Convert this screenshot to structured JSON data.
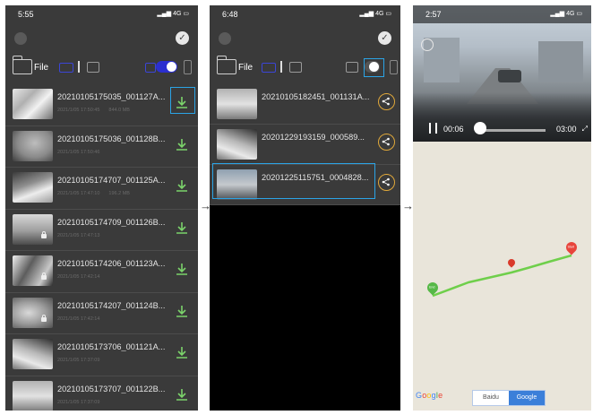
{
  "panel1": {
    "status": {
      "time": "5:55",
      "signal": "4G"
    },
    "toolbar": {
      "file_label": "File"
    },
    "files": [
      {
        "name": "20210105175035_001127A...",
        "date": "2021/1/05 17:50:45",
        "size": "844.0 MB",
        "locked": false
      },
      {
        "name": "20210105175036_001128B...",
        "date": "2021/1/05 17:50:46",
        "size": "",
        "locked": false
      },
      {
        "name": "20210105174707_001125A...",
        "date": "2021/1/05 17:47:10",
        "size": "196.2 MB",
        "locked": false
      },
      {
        "name": "20210105174709_001126B...",
        "date": "2021/1/05 17:47:13",
        "size": "",
        "locked": true
      },
      {
        "name": "20210105174206_001123A...",
        "date": "2021/1/05 17:42:14",
        "size": "",
        "locked": true
      },
      {
        "name": "20210105174207_001124B...",
        "date": "2021/1/05 17:42:14",
        "size": "",
        "locked": true
      },
      {
        "name": "20210105173706_001121A...",
        "date": "2021/1/05 17:37:09",
        "size": "",
        "locked": false
      },
      {
        "name": "20210105173707_001122B...",
        "date": "2021/1/05 17:37:09",
        "size": "",
        "locked": false
      }
    ]
  },
  "panel2": {
    "status": {
      "time": "6:48",
      "signal": "4G"
    },
    "toolbar": {
      "file_label": "File"
    },
    "files": [
      {
        "name": "20210105182451_001131A..."
      },
      {
        "name": "20201229193159_000589..."
      },
      {
        "name": "20201225115751_0004828..."
      }
    ]
  },
  "panel3": {
    "status": {
      "time": "2:57",
      "signal": "4G"
    },
    "player": {
      "current_time": "00:06",
      "total_time": "03:00",
      "progress": 0.03
    },
    "map": {
      "start_label": "End",
      "end_label": "Start",
      "map_providers": [
        "Baidu",
        "Google"
      ],
      "selected_provider": "Google"
    }
  },
  "colors": {
    "highlight": "#2ba4e6",
    "route": "#6fcf4b",
    "share_ring": "#e0a83a",
    "download_icon": "#7bd36b",
    "toggle_on": "#2b2fd0"
  }
}
